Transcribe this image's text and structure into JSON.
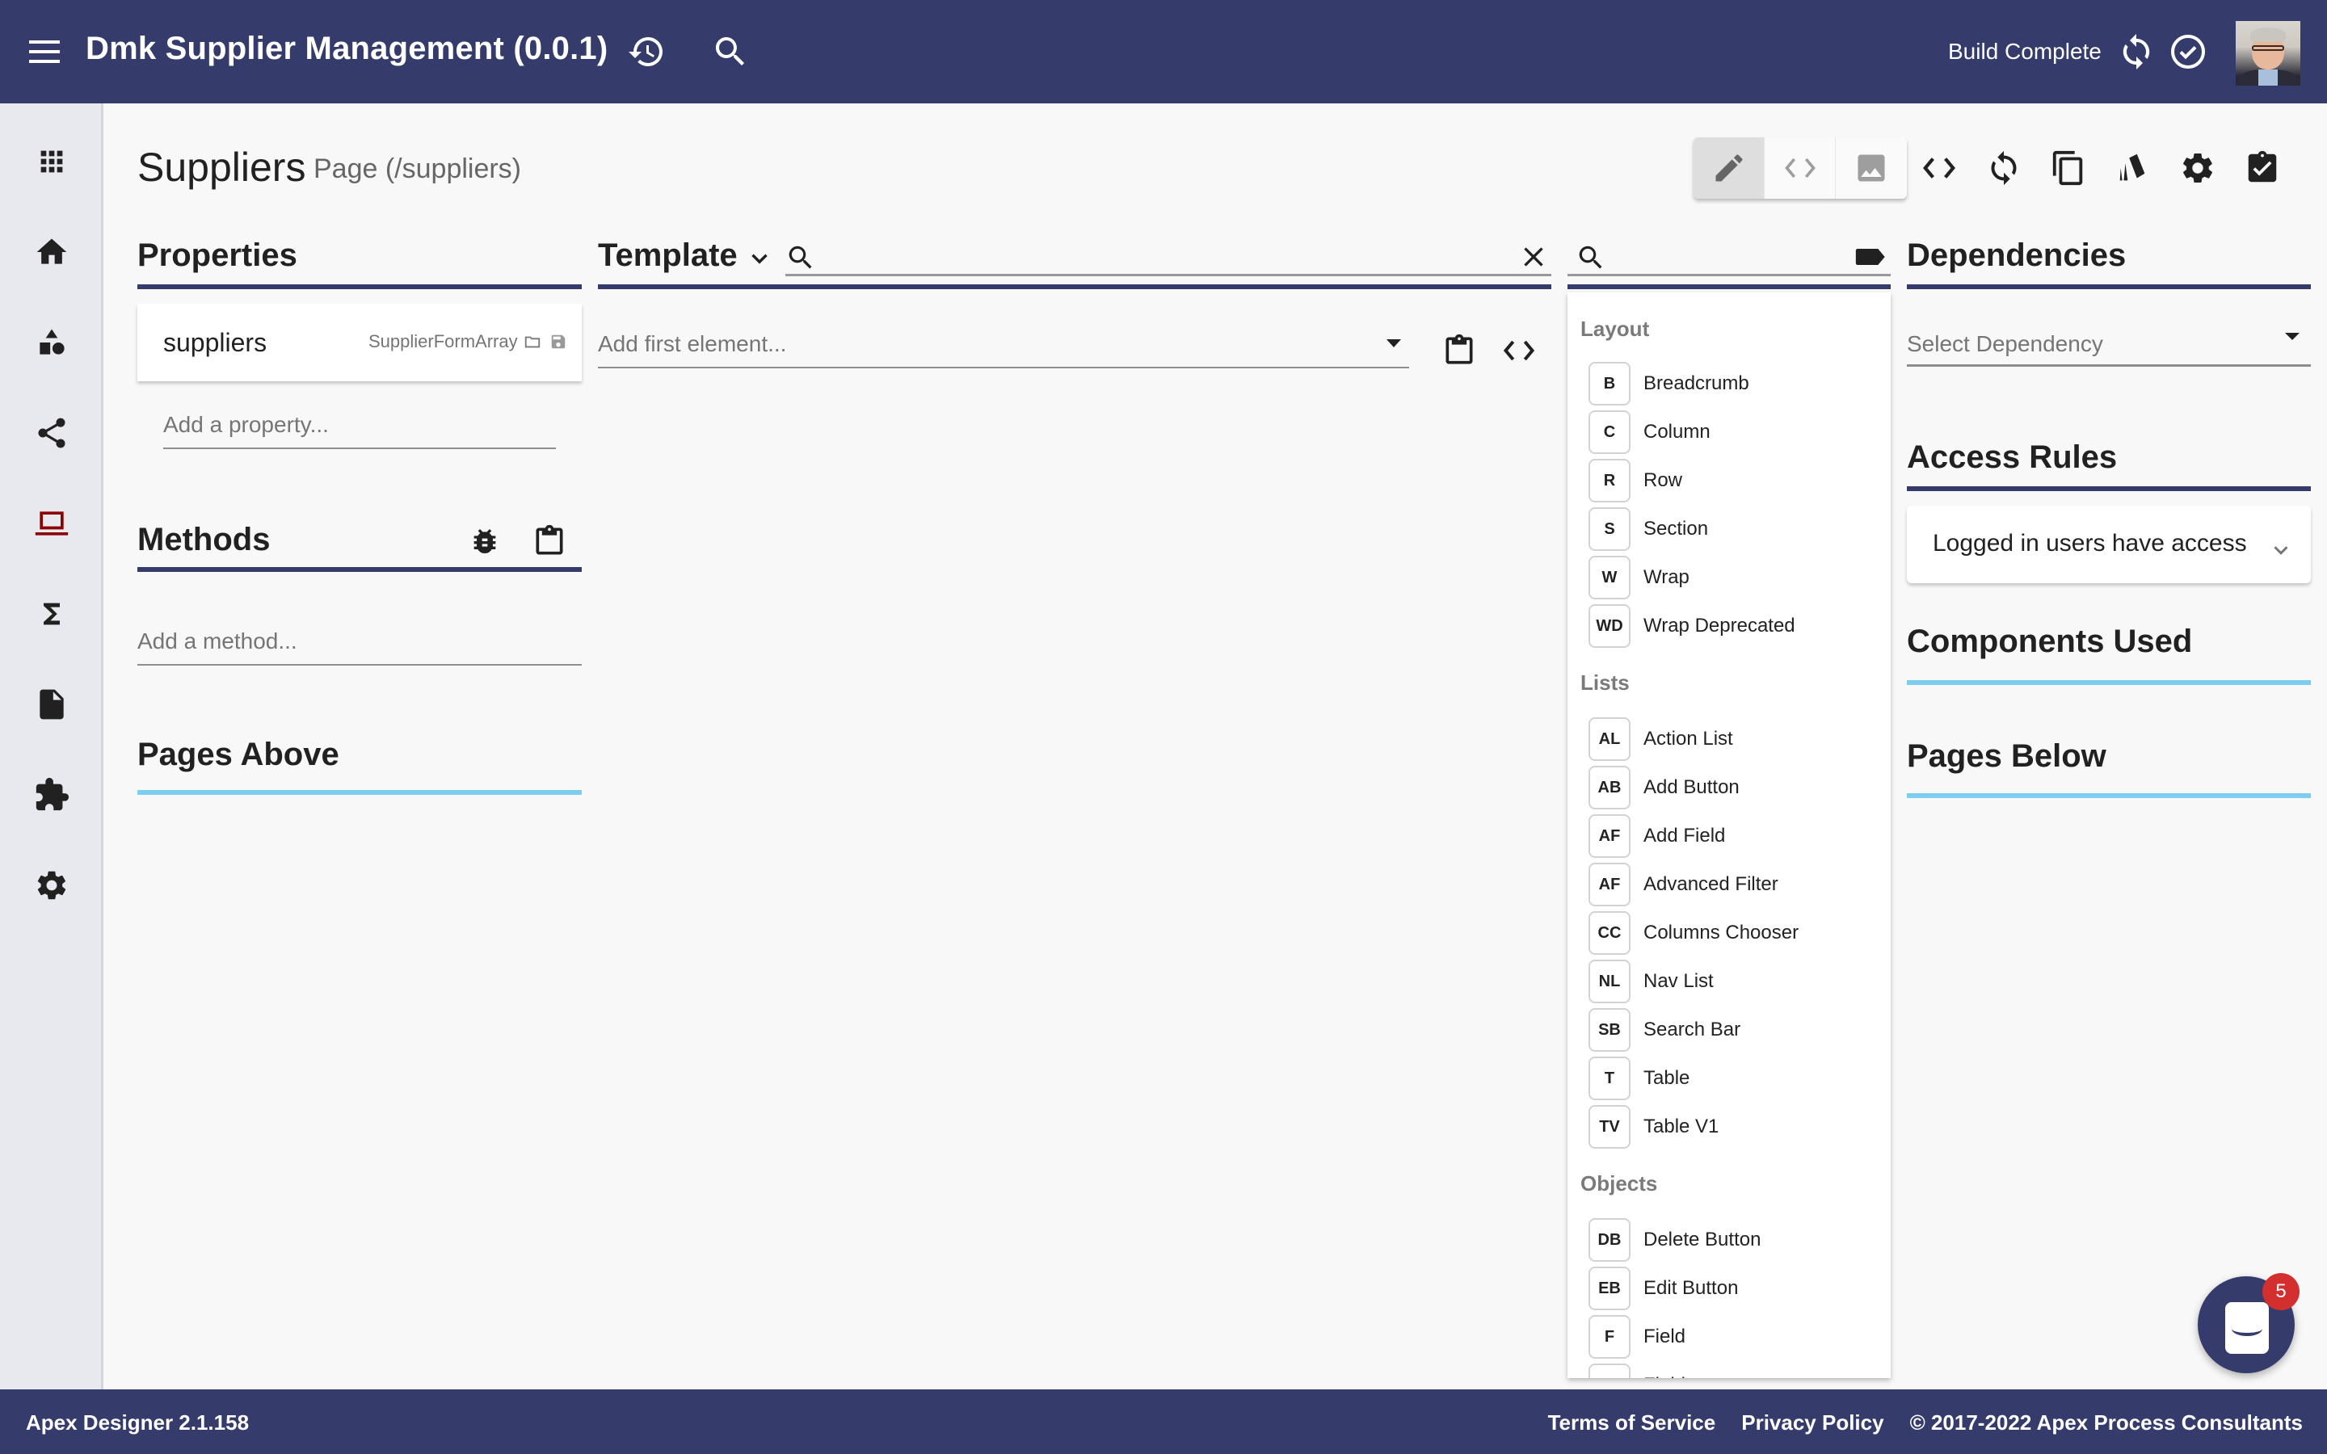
{
  "header": {
    "app_title": "Dmk Supplier Management (0.0.1)",
    "build_status": "Build Complete",
    "icons": [
      "menu-icon",
      "history-icon",
      "search-icon",
      "sync-icon",
      "check-circle-icon",
      "avatar"
    ]
  },
  "sidenav": {
    "items": [
      {
        "name": "apps",
        "icon": "apps-grid-icon"
      },
      {
        "name": "home",
        "icon": "home-icon"
      },
      {
        "name": "business-objects",
        "icon": "shapes-icon"
      },
      {
        "name": "relationships",
        "icon": "share-icon"
      },
      {
        "name": "user-interfaces",
        "icon": "laptop-icon",
        "active": true
      },
      {
        "name": "functions",
        "icon": "sigma-icon"
      },
      {
        "name": "files",
        "icon": "file-icon"
      },
      {
        "name": "libraries",
        "icon": "puzzle-icon"
      },
      {
        "name": "settings",
        "icon": "gear-icon"
      }
    ],
    "active_color": "#8b0000"
  },
  "page": {
    "title": "Suppliers",
    "subtitle": "Page (/suppliers)"
  },
  "toolbar": {
    "view_toggle": [
      "edit-mode",
      "code-mode",
      "preview-mode"
    ],
    "active_view": "edit-mode",
    "actions": [
      "code-icon",
      "refresh-icon",
      "copy-icon",
      "themes-icon",
      "settings-icon",
      "checklist-icon"
    ]
  },
  "properties": {
    "header": "Properties",
    "items": [
      {
        "name": "suppliers",
        "type": "SupplierFormArray"
      }
    ],
    "add_placeholder": "Add a property..."
  },
  "methods": {
    "header": "Methods",
    "add_placeholder": "Add a method..."
  },
  "pages_above": {
    "header": "Pages Above"
  },
  "template": {
    "header": "Template",
    "search_value": "",
    "add_first_placeholder": "Add first element..."
  },
  "palette": {
    "search_value": "",
    "groups": [
      {
        "label": "Layout",
        "items": [
          {
            "abbr": "B",
            "label": "Breadcrumb"
          },
          {
            "abbr": "C",
            "label": "Column"
          },
          {
            "abbr": "R",
            "label": "Row"
          },
          {
            "abbr": "S",
            "label": "Section"
          },
          {
            "abbr": "W",
            "label": "Wrap"
          },
          {
            "abbr": "WD",
            "label": "Wrap Deprecated"
          }
        ]
      },
      {
        "label": "Lists",
        "items": [
          {
            "abbr": "AL",
            "label": "Action List"
          },
          {
            "abbr": "AB",
            "label": "Add Button"
          },
          {
            "abbr": "AF",
            "label": "Add Field"
          },
          {
            "abbr": "AF",
            "label": "Advanced Filter"
          },
          {
            "abbr": "CC",
            "label": "Columns Chooser"
          },
          {
            "abbr": "NL",
            "label": "Nav List"
          },
          {
            "abbr": "SB",
            "label": "Search Bar"
          },
          {
            "abbr": "T",
            "label": "Table"
          },
          {
            "abbr": "TV",
            "label": "Table V1"
          }
        ]
      },
      {
        "label": "Objects",
        "items": [
          {
            "abbr": "DB",
            "label": "Delete Button"
          },
          {
            "abbr": "EB",
            "label": "Edit Button"
          },
          {
            "abbr": "F",
            "label": "Field"
          },
          {
            "abbr": "F",
            "label": "Fields"
          }
        ]
      }
    ]
  },
  "dependencies": {
    "header": "Dependencies",
    "select_placeholder": "Select Dependency"
  },
  "access_rules": {
    "header": "Access Rules",
    "value": "Logged in users have access"
  },
  "components_used": {
    "header": "Components Used"
  },
  "pages_below": {
    "header": "Pages Below"
  },
  "chat": {
    "unread_count": "5"
  },
  "footer": {
    "version": "Apex Designer 2.1.158",
    "links": [
      "Terms of Service",
      "Privacy Policy"
    ],
    "copyright": "© 2017-2022 Apex Process Consultants"
  },
  "colors": {
    "primary": "#353c6b",
    "accent_light": "#7ccdf0",
    "badge_red": "#d32f2f",
    "background": "#f8f8f8"
  }
}
